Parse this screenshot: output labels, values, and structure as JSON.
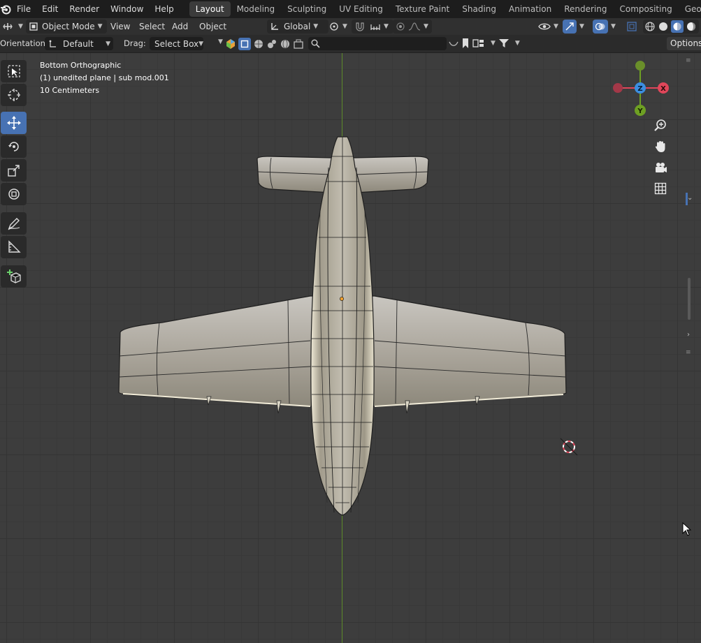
{
  "topbar": {
    "menus": [
      "File",
      "Edit",
      "Render",
      "Window",
      "Help"
    ],
    "workspaces": [
      "Layout",
      "Modeling",
      "Sculpting",
      "UV Editing",
      "Texture Paint",
      "Shading",
      "Animation",
      "Rendering",
      "Compositing",
      "Geometry Nodes"
    ],
    "active_workspace": "Layout"
  },
  "header": {
    "mode": "Object Mode",
    "menus": [
      "View",
      "Select",
      "Add",
      "Object"
    ],
    "transform_orientation": "Global"
  },
  "tool_settings": {
    "orientation_label": "Orientation:",
    "orientation_value": "Default",
    "drag_label": "Drag:",
    "drag_value": "Select Box",
    "search_placeholder": "",
    "options_label": "Options"
  },
  "viewport": {
    "view_name": "Bottom Orthographic",
    "object_info": "(1) unedited plane | sub mod.001",
    "grid_scale": "10 Centimeters"
  },
  "gizmo": {
    "axes": {
      "x": "X",
      "y": "Y",
      "z": "Z"
    },
    "colors": {
      "x": "#e0465a",
      "y": "#6ea023",
      "z": "#3c8ee0",
      "active": "#4772b3"
    }
  }
}
